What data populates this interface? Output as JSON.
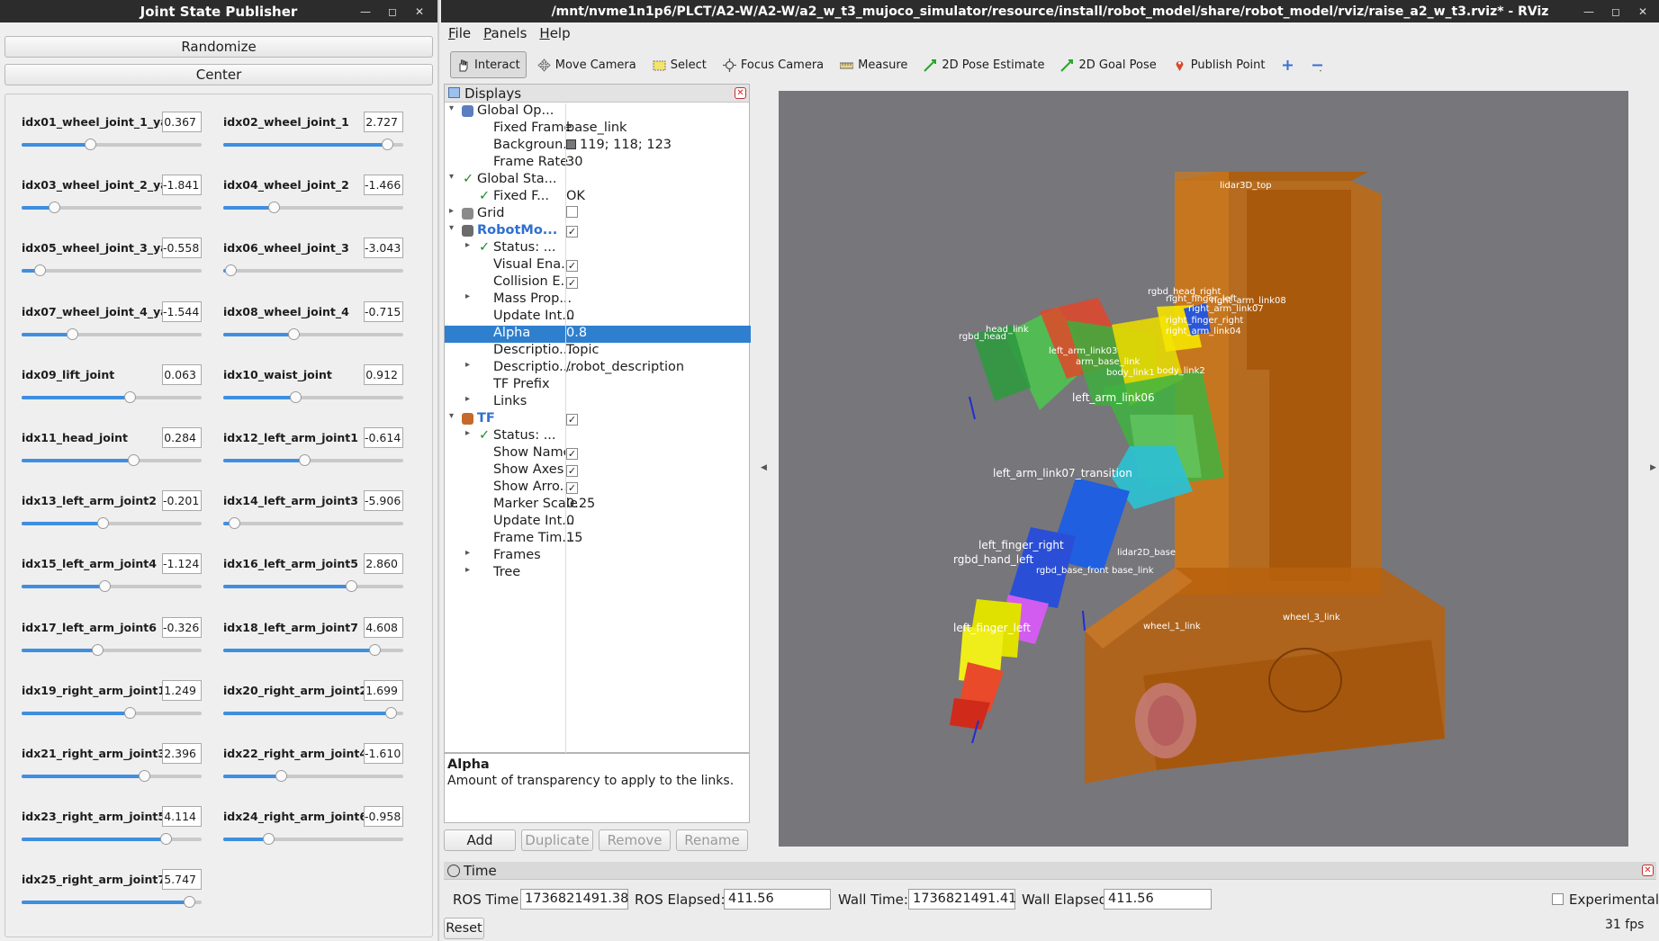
{
  "jsp": {
    "title": "Joint State Publisher",
    "randomize": "Randomize",
    "center": "Center",
    "joints": [
      {
        "name": "idx01_wheel_joint_1_yaw",
        "value": "0.367",
        "pos": 0.38
      },
      {
        "name": "idx02_wheel_joint_1",
        "value": "2.727",
        "pos": 0.91
      },
      {
        "name": "idx03_wheel_joint_2_yaw",
        "value": "-1.841",
        "pos": 0.18
      },
      {
        "name": "idx04_wheel_joint_2",
        "value": "-1.466",
        "pos": 0.28
      },
      {
        "name": "idx05_wheel_joint_3_yaw",
        "value": "-0.558",
        "pos": 0.1
      },
      {
        "name": "idx06_wheel_joint_3",
        "value": "-3.043",
        "pos": 0.04
      },
      {
        "name": "idx07_wheel_joint_4_yaw",
        "value": "-1.544",
        "pos": 0.28
      },
      {
        "name": "idx08_wheel_joint_4",
        "value": "-0.715",
        "pos": 0.39
      },
      {
        "name": "idx09_lift_joint",
        "value": "0.063",
        "pos": 0.6
      },
      {
        "name": "idx10_waist_joint",
        "value": "0.912",
        "pos": 0.4
      },
      {
        "name": "idx11_head_joint",
        "value": "0.284",
        "pos": 0.62
      },
      {
        "name": "idx12_left_arm_joint1",
        "value": "-0.614",
        "pos": 0.45
      },
      {
        "name": "idx13_left_arm_joint2",
        "value": "-0.201",
        "pos": 0.45
      },
      {
        "name": "idx14_left_arm_joint3",
        "value": "-5.906",
        "pos": 0.06
      },
      {
        "name": "idx15_left_arm_joint4",
        "value": "-1.124",
        "pos": 0.46
      },
      {
        "name": "idx16_left_arm_joint5",
        "value": "2.860",
        "pos": 0.71
      },
      {
        "name": "idx17_left_arm_joint6",
        "value": "-0.326",
        "pos": 0.42
      },
      {
        "name": "idx18_left_arm_joint7",
        "value": "4.608",
        "pos": 0.84
      },
      {
        "name": "idx19_right_arm_joint1",
        "value": "1.249",
        "pos": 0.6
      },
      {
        "name": "idx20_right_arm_joint2",
        "value": "1.699",
        "pos": 0.93
      },
      {
        "name": "idx21_right_arm_joint3",
        "value": "2.396",
        "pos": 0.68
      },
      {
        "name": "idx22_right_arm_joint4",
        "value": "-1.610",
        "pos": 0.32
      },
      {
        "name": "idx23_right_arm_joint5",
        "value": "4.114",
        "pos": 0.8
      },
      {
        "name": "idx24_right_arm_joint6",
        "value": "-0.958",
        "pos": 0.25
      },
      {
        "name": "idx25_right_arm_joint7",
        "value": "5.747",
        "pos": 0.93
      }
    ]
  },
  "rviz": {
    "title": "/mnt/nvme1n1p6/PLCT/A2-W/A2-W/a2_w_t3_mujoco_simulator/resource/install/robot_model/share/robot_model/rviz/raise_a2_w_t3.rviz* - RViz",
    "menu": [
      "File",
      "Panels",
      "Help"
    ],
    "tools": [
      {
        "label": "Interact",
        "icon": "hand-icon",
        "active": true
      },
      {
        "label": "Move Camera",
        "icon": "move-camera-icon"
      },
      {
        "label": "Select",
        "icon": "select-box-icon"
      },
      {
        "label": "Focus Camera",
        "icon": "focus-camera-icon"
      },
      {
        "label": "Measure",
        "icon": "ruler-icon"
      },
      {
        "label": "2D Pose Estimate",
        "icon": "green-arrow-icon"
      },
      {
        "label": "2D Goal Pose",
        "icon": "green-arrow-icon"
      },
      {
        "label": "Publish Point",
        "icon": "map-pin-icon"
      }
    ],
    "displays_title": "Displays",
    "props": [
      {
        "i": 0,
        "arrow": "▾",
        "name": "Global Op...",
        "value": "",
        "icon": "gear"
      },
      {
        "i": 1,
        "name": "Fixed Frame",
        "value": "base_link"
      },
      {
        "i": 1,
        "name": "Backgroun...",
        "value": "119; 118; 123",
        "swatch": "#77767b"
      },
      {
        "i": 1,
        "name": "Frame Rate",
        "value": "30"
      },
      {
        "i": 0,
        "arrow": "▾",
        "name": "Global Sta...",
        "value": "",
        "tick": true
      },
      {
        "i": 1,
        "name": "Fixed F...",
        "value": "OK",
        "tick": true
      },
      {
        "i": 0,
        "arrow": "▸",
        "name": "Grid",
        "value": "",
        "icon": "grid",
        "check": false
      },
      {
        "i": 0,
        "arrow": "▾",
        "name": "RobotMo...",
        "value": "",
        "icon": "robot",
        "check": true,
        "blue": true
      },
      {
        "i": 1,
        "arrow": "▸",
        "name": "Status: ...",
        "value": "",
        "tick": true
      },
      {
        "i": 1,
        "name": "Visual Ena...",
        "value": "",
        "check": true
      },
      {
        "i": 1,
        "name": "Collision E...",
        "value": "",
        "check": true
      },
      {
        "i": 1,
        "arrow": "▸",
        "name": "Mass Prop...",
        "value": ""
      },
      {
        "i": 1,
        "name": "Update Int...",
        "value": "0"
      },
      {
        "i": 1,
        "name": "Alpha",
        "value": "0.8",
        "selected": true
      },
      {
        "i": 1,
        "name": "Descriptio...",
        "value": "Topic"
      },
      {
        "i": 1,
        "arrow": "▸",
        "name": "Descriptio...",
        "value": "/robot_description"
      },
      {
        "i": 1,
        "name": "TF Prefix",
        "value": ""
      },
      {
        "i": 1,
        "arrow": "▸",
        "name": "Links",
        "value": ""
      },
      {
        "i": 0,
        "arrow": "▾",
        "name": "TF",
        "value": "",
        "icon": "tf",
        "check": true,
        "blue": true
      },
      {
        "i": 1,
        "arrow": "▸",
        "name": "Status: ...",
        "value": "",
        "tick": true
      },
      {
        "i": 1,
        "name": "Show Names",
        "value": "",
        "check": true
      },
      {
        "i": 1,
        "name": "Show Axes",
        "value": "",
        "check": true
      },
      {
        "i": 1,
        "name": "Show Arro...",
        "value": "",
        "check": true
      },
      {
        "i": 1,
        "name": "Marker Scale",
        "value": "0.25"
      },
      {
        "i": 1,
        "name": "Update Int...",
        "value": "0"
      },
      {
        "i": 1,
        "name": "Frame Tim...",
        "value": "15"
      },
      {
        "i": 1,
        "arrow": "▸",
        "name": "Frames",
        "value": ""
      },
      {
        "i": 1,
        "arrow": "▸",
        "name": "Tree",
        "value": ""
      }
    ],
    "desc_title": "Alpha",
    "desc_text": "Amount of transparency to apply to the links.",
    "buttons": {
      "add": "Add",
      "duplicate": "Duplicate",
      "remove": "Remove",
      "rename": "Rename"
    },
    "time": {
      "title": "Time",
      "ros_time_label": "ROS Time:",
      "ros_time": "1736821491.38",
      "ros_elapsed_label": "ROS Elapsed:",
      "ros_elapsed": "411.56",
      "wall_time_label": "Wall Time:",
      "wall_time": "1736821491.41",
      "wall_elapsed_label": "Wall Elapsed:",
      "wall_elapsed": "411.56",
      "experimental": "Experimental",
      "reset": "Reset",
      "fps": "31 fps"
    },
    "viewport_bg": "#77767b",
    "tf_labels": [
      "lidar3D_top",
      "rgbd_head_right",
      "right_finger_left",
      "right_arm_link08",
      "right_arm_link07",
      "right_finger_right",
      "right_arm_link04",
      "head_link",
      "rgbd_head",
      "left_arm_link03",
      "arm_base_link",
      "body_link1",
      "body_link2",
      "left_arm_link06",
      "left_arm_link07_transition",
      "rgbd_hand_left",
      "left_finger_right",
      "left_finger_left",
      "lidar2D_base",
      "rgbd_base_front",
      "base_link",
      "wheel_1_link",
      "wheel_3_link"
    ]
  }
}
